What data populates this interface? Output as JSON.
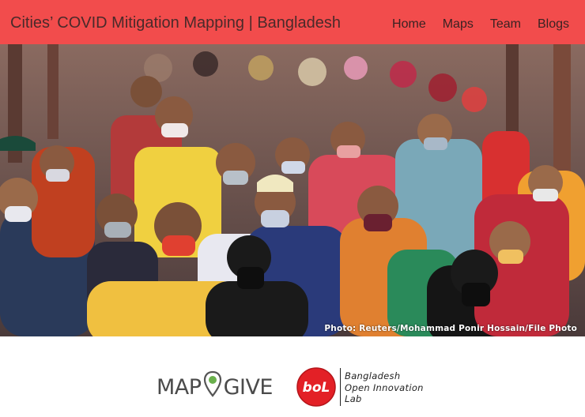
{
  "header": {
    "title": "Cities’ COVID Mitigation Mapping | Bangladesh",
    "nav": [
      {
        "label": "Home"
      },
      {
        "label": "Maps"
      },
      {
        "label": "Team"
      },
      {
        "label": "Blogs"
      }
    ],
    "background_color": "#f24c4c"
  },
  "hero": {
    "image_subject": "crowd of people wearing face masks",
    "credit": "Photo: Reuters/Mohammad Ponir Hossain/File Photo"
  },
  "footer": {
    "mapgive": {
      "left_word": "MAP",
      "right_word": "GIVE",
      "icon": "map-pin-icon"
    },
    "bol": {
      "logo_text": "boL",
      "lines": [
        "Bangladesh",
        "Open Innovation",
        "Lab"
      ],
      "logo_color": "#e32026"
    }
  }
}
